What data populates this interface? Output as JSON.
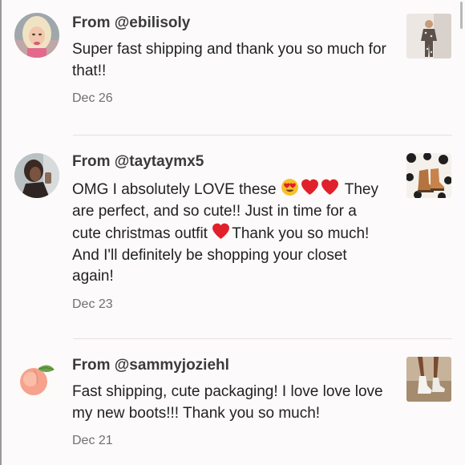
{
  "comments": [
    {
      "from": "From @ebilisoly",
      "text": "Super fast shipping and thank you so much for that!!",
      "date": "Dec 26",
      "avatar_icon": "user-avatar-photo",
      "thumbnail_icon": "listing-photo-pajamas"
    },
    {
      "from": "From @taytaymx5",
      "text_parts": [
        "OMG I absolutely LOVE these ",
        " They are perfect, and so cute!! Just in time for a cute christmas outfit ",
        "Thank you so much! And I'll definitely be shopping your closet again!"
      ],
      "emojis": [
        "heart-eyes-emoji",
        "red-heart-emoji",
        "red-heart-emoji",
        "red-heart-emoji"
      ],
      "date": "Dec 23",
      "avatar_icon": "user-avatar-photo",
      "thumbnail_icon": "listing-photo-boots"
    },
    {
      "from": "From @sammyjoziehl",
      "text": "Fast shipping, cute packaging! I love love love my new boots!!! Thank you so much!",
      "date": "Dec 21",
      "avatar_icon": "peach-avatar",
      "thumbnail_icon": "listing-photo-white-boots"
    }
  ],
  "colors": {
    "background": "#fcfafa",
    "divider": "#e5e1e1",
    "date_text": "#707070",
    "heart": "#e0202a"
  }
}
